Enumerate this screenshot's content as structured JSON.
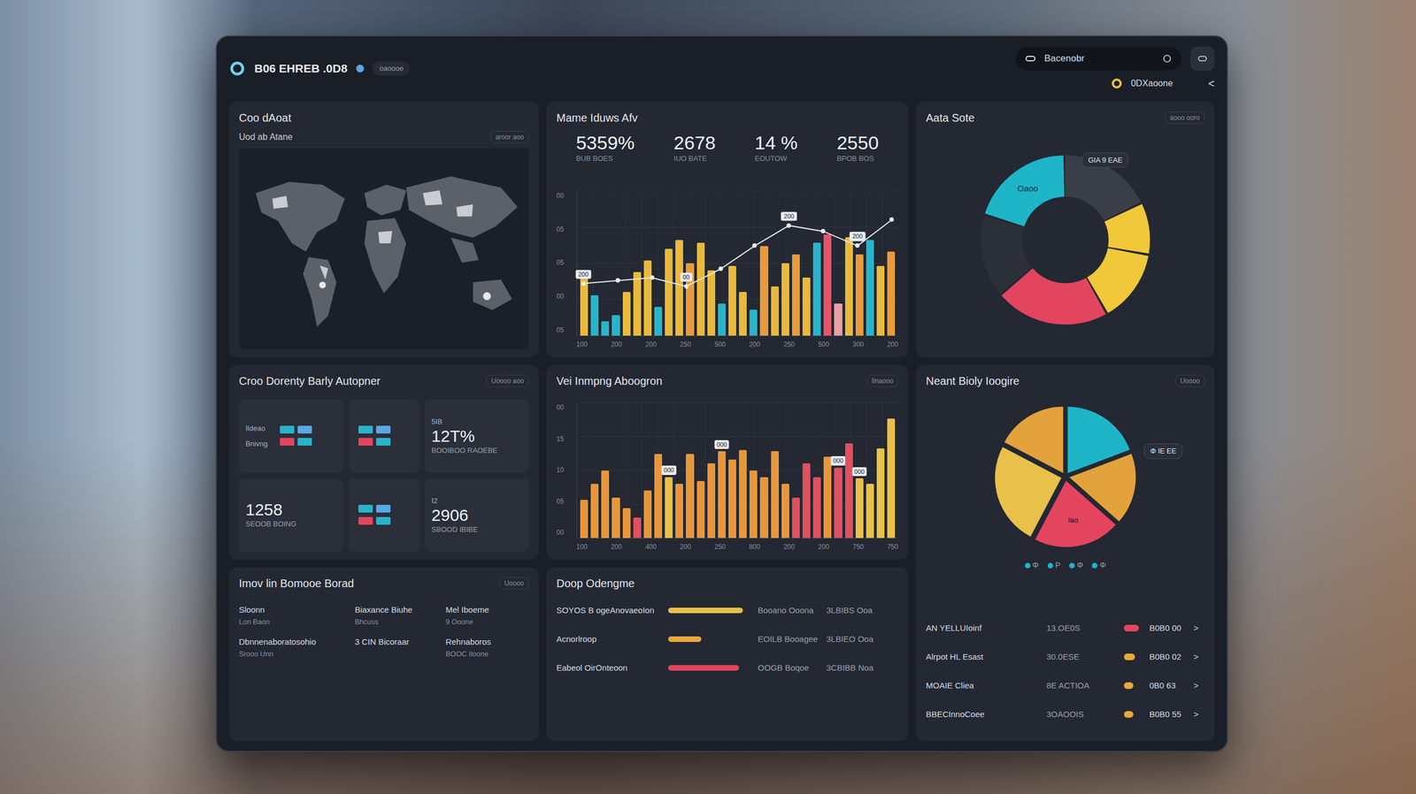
{
  "header": {
    "logo_text": "B06 EHREB .0D8",
    "status": "oaoooe",
    "search": "Bacenobr",
    "user": "0DXaoone",
    "back_icon": "<"
  },
  "map_panel": {
    "title": "Coo dAoat",
    "subtitle": "Uod ab Atane",
    "menu": "aroor aoo"
  },
  "kpi_panel": {
    "title": "Mame Iduws Afv",
    "kpis": [
      {
        "value": "5359%",
        "label": "BUB BOES"
      },
      {
        "value": "2678",
        "label": "IUO BATE"
      },
      {
        "value": "14 %",
        "label": "EOUTOW"
      },
      {
        "value": "2550",
        "label": "BPOB BOS"
      }
    ],
    "chart": {
      "y_ticks": [
        "00",
        "05",
        "05",
        "00",
        "05"
      ],
      "x_ticks": [
        "100",
        "200",
        "200",
        "250",
        "500",
        "200",
        "250",
        "500",
        "300",
        "200"
      ],
      "bars": [
        {
          "value": 42,
          "color": "#e8b93c"
        },
        {
          "value": 28,
          "color": "#2ab3c9"
        },
        {
          "value": 10,
          "color": "#2ab3c9"
        },
        {
          "value": 14,
          "color": "#2ab3c9"
        },
        {
          "value": 30,
          "color": "#e8b93c"
        },
        {
          "value": 44,
          "color": "#e8b93c"
        },
        {
          "value": 52,
          "color": "#e8b93c"
        },
        {
          "value": 20,
          "color": "#2ab3c9"
        },
        {
          "value": 60,
          "color": "#e8b93c"
        },
        {
          "value": 66,
          "color": "#e8b93c"
        },
        {
          "value": 50,
          "color": "#e89a3c"
        },
        {
          "value": 64,
          "color": "#e8b93c"
        },
        {
          "value": 45,
          "color": "#e8b93c"
        },
        {
          "value": 22,
          "color": "#2ab3c9"
        },
        {
          "value": 48,
          "color": "#e8b93c"
        },
        {
          "value": 30,
          "color": "#e8b93c"
        },
        {
          "value": 18,
          "color": "#2ab3c9"
        },
        {
          "value": 62,
          "color": "#e89a3c"
        },
        {
          "value": 34,
          "color": "#e8b93c"
        },
        {
          "value": 50,
          "color": "#e8b93c"
        },
        {
          "value": 56,
          "color": "#e89a3c"
        },
        {
          "value": 40,
          "color": "#e8b93c"
        },
        {
          "value": 64,
          "color": "#2ab3c9"
        },
        {
          "value": 70,
          "color": "#e2556a"
        },
        {
          "value": 22,
          "color": "#e8a0a0"
        },
        {
          "value": 68,
          "color": "#e8b93c"
        },
        {
          "value": 56,
          "color": "#e89a3c"
        },
        {
          "value": 66,
          "color": "#2ab3c9"
        },
        {
          "value": 48,
          "color": "#e8b93c"
        },
        {
          "value": 58,
          "color": "#e89a3c"
        }
      ],
      "line": [
        {
          "value": 36,
          "label": "200"
        },
        {
          "value": 38,
          "label": ""
        },
        {
          "value": 40,
          "label": ""
        },
        {
          "value": 34,
          "label": "00"
        },
        {
          "value": 46,
          "label": ""
        },
        {
          "value": 62,
          "label": ""
        },
        {
          "value": 76,
          "label": "200"
        },
        {
          "value": 72,
          "label": ""
        },
        {
          "value": 62,
          "label": "200"
        },
        {
          "value": 80,
          "label": ""
        }
      ]
    }
  },
  "share_panel": {
    "title": "Aata Sote",
    "menu": "aooo ooro",
    "tooltip": "GIA 9 EAE",
    "segments": [
      {
        "value": 18,
        "color": "#3a3f47",
        "label": ""
      },
      {
        "value": 10,
        "color": "#f0c83a",
        "label": ""
      },
      {
        "value": 14,
        "color": "#f0c83a",
        "label": ""
      },
      {
        "value": 22,
        "color": "#e3455f",
        "label": ""
      },
      {
        "value": 16,
        "color": "#2c3038",
        "label": ""
      },
      {
        "value": 20,
        "color": "#1fb5c9",
        "label": "Oaoo"
      }
    ]
  },
  "tiles_panel": {
    "title": "Croo Dorenty Barly Autopner",
    "menu": "Uoooo aoo",
    "tiles": [
      {
        "kind": "graphic",
        "lines": [
          "Ildeao",
          "Bnivng"
        ]
      },
      {
        "kind": "graphic",
        "lines": []
      },
      {
        "kind": "stat",
        "caption": "5IB",
        "value": "12T%",
        "label": "BOOIBOO RAOEBE"
      },
      {
        "kind": "stat",
        "caption": "",
        "value": "1258",
        "label": "SEOOB BOING"
      },
      {
        "kind": "graphic",
        "lines": []
      },
      {
        "kind": "stat",
        "caption": "I2",
        "value": "2906",
        "label": "SBOOD IBIBE"
      }
    ]
  },
  "trend_panel": {
    "title": "Vei Inmpng Aboogron",
    "menu": "Ilnaooo",
    "chart": {
      "y_ticks": [
        "00",
        "15",
        "10",
        "05",
        "00"
      ],
      "x_ticks": [
        "100",
        "200",
        "400",
        "200",
        "250",
        "800",
        "200",
        "200",
        "750",
        "750"
      ],
      "bars": [
        {
          "value": 28,
          "color": "#e8963c",
          "label": ""
        },
        {
          "value": 40,
          "color": "#e8963c",
          "label": ""
        },
        {
          "value": 50,
          "color": "#e8963c",
          "label": ""
        },
        {
          "value": 30,
          "color": "#e8963c",
          "label": ""
        },
        {
          "value": 22,
          "color": "#e8963c",
          "label": ""
        },
        {
          "value": 15,
          "color": "#e0505f",
          "label": ""
        },
        {
          "value": 35,
          "color": "#e8963c",
          "label": ""
        },
        {
          "value": 62,
          "color": "#e8963c",
          "label": ""
        },
        {
          "value": 45,
          "color": "#e8c04a",
          "label": "000"
        },
        {
          "value": 40,
          "color": "#e8963c",
          "label": ""
        },
        {
          "value": 62,
          "color": "#e8963c",
          "label": ""
        },
        {
          "value": 42,
          "color": "#e8963c",
          "label": ""
        },
        {
          "value": 55,
          "color": "#e8963c",
          "label": ""
        },
        {
          "value": 64,
          "color": "#e8963c",
          "label": "000"
        },
        {
          "value": 58,
          "color": "#e8963c",
          "label": ""
        },
        {
          "value": 65,
          "color": "#e8963c",
          "label": ""
        },
        {
          "value": 50,
          "color": "#e8963c",
          "label": ""
        },
        {
          "value": 45,
          "color": "#e8963c",
          "label": ""
        },
        {
          "value": 64,
          "color": "#e8963c",
          "label": ""
        },
        {
          "value": 40,
          "color": "#e8963c",
          "label": ""
        },
        {
          "value": 30,
          "color": "#e0505f",
          "label": ""
        },
        {
          "value": 55,
          "color": "#e0505f",
          "label": ""
        },
        {
          "value": 45,
          "color": "#e0505f",
          "label": ""
        },
        {
          "value": 60,
          "color": "#e8963c",
          "label": ""
        },
        {
          "value": 52,
          "color": "#e0505f",
          "label": "000"
        },
        {
          "value": 70,
          "color": "#e0505f",
          "label": ""
        },
        {
          "value": 44,
          "color": "#e8c04a",
          "label": "000"
        },
        {
          "value": 40,
          "color": "#e8c04a",
          "label": ""
        },
        {
          "value": 66,
          "color": "#e8c04a",
          "label": ""
        },
        {
          "value": 88,
          "color": "#e8c04a",
          "label": ""
        }
      ]
    }
  },
  "pie_panel": {
    "title": "Neant Bioly Ioogire",
    "menu": "Uoooo",
    "tooltip": "Φ IE EE",
    "segments": [
      {
        "value": 20,
        "color": "#1fb5c9",
        "label": ""
      },
      {
        "value": 18,
        "color": "#e3a23c",
        "label": ""
      },
      {
        "value": 22,
        "color": "#e3455f",
        "label": "lao"
      },
      {
        "value": 26,
        "color": "#e8c04a",
        "label": ""
      },
      {
        "value": 18,
        "color": "#e3a23c",
        "label": ""
      }
    ],
    "legend": [
      {
        "label": "Φ",
        "color": "#1fb5c9"
      },
      {
        "label": "P",
        "color": "#1fb5c9"
      },
      {
        "label": "Φ",
        "color": "#1fb5c9"
      },
      {
        "label": "Φ",
        "color": "#1fb5c9"
      }
    ],
    "rows": [
      {
        "name": "AN YELLUIoinf",
        "value": "13.OE0S",
        "level": 0.8,
        "color": "#e3455f",
        "reading": "B0B0 00",
        "arrow": ">"
      },
      {
        "name": "Alrpot HL Esast",
        "value": "30.0ESE",
        "level": 0.6,
        "color": "#e8a83c",
        "reading": "B0B0 02",
        "arrow": ">"
      },
      {
        "name": "MOAIE Cliea",
        "value": "8E ACTIOA",
        "level": 0.5,
        "color": "#e8a83c",
        "reading": "0B0 63",
        "arrow": ">"
      },
      {
        "name": "BBECInnoCoee",
        "value": "3OAOOIS",
        "level": 0.5,
        "color": "#e8a83c",
        "reading": "B0B0 55",
        "arrow": ">"
      }
    ]
  },
  "list_panel": {
    "title": "Imov lin Bomooe Borad",
    "menu": "Uoooo",
    "items": [
      {
        "title": "Sloonn",
        "sub": "Lon Baon"
      },
      {
        "title": "Biaxance Biuhe",
        "sub": "Bhcuss"
      },
      {
        "title": "Mel Iboeme",
        "sub": "9 Ooone"
      },
      {
        "title": "Dbnnenaboratosohio",
        "sub": "Srooo Unn"
      },
      {
        "title": "3 CIN Bicoraar",
        "sub": ""
      },
      {
        "title": "Rehnaboros",
        "sub": "BOOC Iloone"
      }
    ]
  },
  "bars_panel": {
    "title": "Doop Odengme",
    "rows": [
      {
        "name": "SOYOS B ogeAnovaeoIon",
        "level": 0.9,
        "color": "#e8c04a",
        "label": "Booano Ooona",
        "reading": "3LBIBS Ooa"
      },
      {
        "name": "Acnorlroop",
        "level": 0.4,
        "color": "#e8a83c",
        "label": "EOILB Booagee",
        "reading": "3LBIEO Ooa"
      },
      {
        "name": "Eabeol OirOnteoon",
        "level": 0.85,
        "color": "#e3455f",
        "label": "OOGB Boqoe",
        "reading": "3CBIBB Noa"
      }
    ]
  }
}
